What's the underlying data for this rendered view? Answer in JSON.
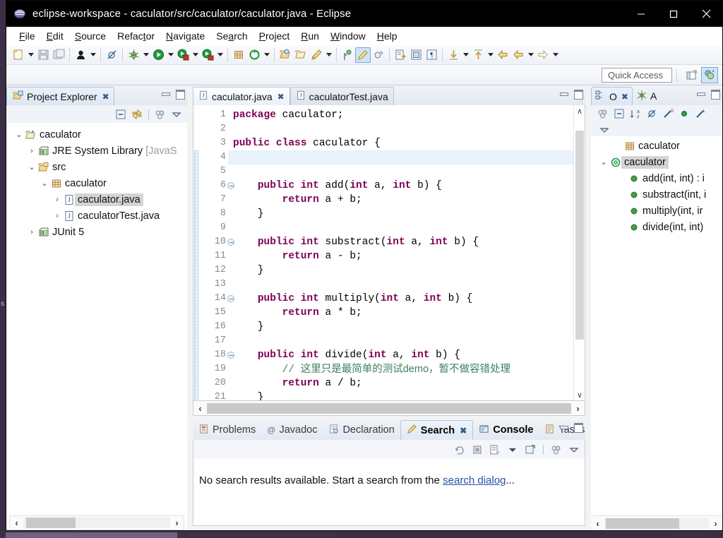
{
  "window": {
    "title": "eclipse-workspace - caculator/src/caculator/caculator.java - Eclipse",
    "icon": "eclipse-globe-icon",
    "minimize_label": "—",
    "maximize_label": "☐",
    "close_label": "✕"
  },
  "menubar": {
    "items": [
      {
        "label": "File",
        "mnemonic": "F"
      },
      {
        "label": "Edit",
        "mnemonic": "E"
      },
      {
        "label": "Source",
        "mnemonic": "S"
      },
      {
        "label": "Refactor",
        "mnemonic": "t"
      },
      {
        "label": "Navigate",
        "mnemonic": "N"
      },
      {
        "label": "Search",
        "mnemonic": "a"
      },
      {
        "label": "Project",
        "mnemonic": "P"
      },
      {
        "label": "Run",
        "mnemonic": "R"
      },
      {
        "label": "Window",
        "mnemonic": "W"
      },
      {
        "label": "Help",
        "mnemonic": "H"
      }
    ]
  },
  "toolbar": {
    "icons": [
      "new-wizard-icon",
      "save-icon",
      "save-all-icon",
      "toggle-breadcrumb-icon",
      "skip-breakpoints-icon",
      "debug-icon",
      "run-icon",
      "run-external-tools-icon",
      "coverage-icon",
      "new-java-package-icon",
      "new-java-class-icon",
      "open-type-icon",
      "open-task-icon",
      "search-icon",
      "next-annotation-icon",
      "previous-annotation-icon",
      "last-edit-location-icon",
      "back-icon",
      "forward-icon"
    ]
  },
  "quick_access": {
    "placeholder": "Quick Access",
    "value": "Quick Access",
    "open_perspective_icon": "open-perspective-icon",
    "java_perspective_icon": "java-perspective-icon"
  },
  "project_explorer": {
    "tab_label": "Project Explorer",
    "tab_icon": "project-explorer-icon",
    "close_label": "✖",
    "toolbar_icons": [
      "collapse-all-icon",
      "link-with-editor-icon",
      "view-menu-icon",
      "view-dropdown-icon"
    ],
    "tree": [
      {
        "label": "caculator",
        "indent": 0,
        "twist": "⌄",
        "icon": "java-project-icon",
        "selected": false,
        "dim": ""
      },
      {
        "label": "JRE System Library ",
        "indent": 1,
        "twist": "›",
        "icon": "library-icon",
        "selected": false,
        "dim": "[JavaS"
      },
      {
        "label": "src",
        "indent": 1,
        "twist": "⌄",
        "icon": "source-folder-icon",
        "selected": false,
        "dim": ""
      },
      {
        "label": "caculator",
        "indent": 2,
        "twist": "⌄",
        "icon": "package-icon",
        "selected": false,
        "dim": ""
      },
      {
        "label": "caculator.java",
        "indent": 3,
        "twist": "›",
        "icon": "java-file-icon",
        "selected": true,
        "dim": ""
      },
      {
        "label": "caculatorTest.java",
        "indent": 3,
        "twist": "›",
        "icon": "java-file-icon",
        "selected": false,
        "dim": ""
      },
      {
        "label": "JUnit 5",
        "indent": 1,
        "twist": "›",
        "icon": "library-icon",
        "selected": false,
        "dim": ""
      }
    ],
    "hscroll": {
      "left_arrow": "‹",
      "right_arrow": "›"
    }
  },
  "editor": {
    "tabs": [
      {
        "label": "caculator.java",
        "icon": "java-file-icon",
        "selected": true,
        "close": "✖"
      },
      {
        "label": "caculatorTest.java",
        "icon": "java-file-icon",
        "selected": false,
        "close": ""
      }
    ],
    "lines": [
      {
        "n": "1",
        "fold": false,
        "highlight": false,
        "tokens": [
          {
            "t": "package",
            "c": "kw"
          },
          {
            "t": " caculator;",
            "c": ""
          }
        ]
      },
      {
        "n": "2",
        "fold": false,
        "highlight": false,
        "tokens": [
          {
            "t": "",
            "c": ""
          }
        ]
      },
      {
        "n": "3",
        "fold": false,
        "highlight": false,
        "tokens": [
          {
            "t": "public class",
            "c": "kw"
          },
          {
            "t": " caculator {",
            "c": ""
          }
        ]
      },
      {
        "n": "4",
        "fold": false,
        "highlight": true,
        "tokens": [
          {
            "t": "",
            "c": ""
          }
        ]
      },
      {
        "n": "5",
        "fold": false,
        "highlight": false,
        "tokens": [
          {
            "t": "",
            "c": ""
          }
        ]
      },
      {
        "n": "6",
        "fold": true,
        "highlight": false,
        "tokens": [
          {
            "t": "\t",
            "c": ""
          },
          {
            "t": "public int",
            "c": "kw"
          },
          {
            "t": " add(",
            "c": ""
          },
          {
            "t": "int",
            "c": "kw"
          },
          {
            "t": " a, ",
            "c": ""
          },
          {
            "t": "int",
            "c": "kw"
          },
          {
            "t": " b) {",
            "c": ""
          }
        ]
      },
      {
        "n": "7",
        "fold": false,
        "highlight": false,
        "tokens": [
          {
            "t": "\t\t",
            "c": ""
          },
          {
            "t": "return",
            "c": "kw"
          },
          {
            "t": " a + b;",
            "c": ""
          }
        ]
      },
      {
        "n": "8",
        "fold": false,
        "highlight": false,
        "tokens": [
          {
            "t": "\t}",
            "c": ""
          }
        ]
      },
      {
        "n": "9",
        "fold": false,
        "highlight": false,
        "tokens": [
          {
            "t": "",
            "c": ""
          }
        ]
      },
      {
        "n": "10",
        "fold": true,
        "highlight": false,
        "tokens": [
          {
            "t": "\t",
            "c": ""
          },
          {
            "t": "public int",
            "c": "kw"
          },
          {
            "t": " substract(",
            "c": ""
          },
          {
            "t": "int",
            "c": "kw"
          },
          {
            "t": " a, ",
            "c": ""
          },
          {
            "t": "int",
            "c": "kw"
          },
          {
            "t": " b) {",
            "c": ""
          }
        ]
      },
      {
        "n": "11",
        "fold": false,
        "highlight": false,
        "tokens": [
          {
            "t": "\t\t",
            "c": ""
          },
          {
            "t": "return",
            "c": "kw"
          },
          {
            "t": " a - b;",
            "c": ""
          }
        ]
      },
      {
        "n": "12",
        "fold": false,
        "highlight": false,
        "tokens": [
          {
            "t": "\t}",
            "c": ""
          }
        ]
      },
      {
        "n": "13",
        "fold": false,
        "highlight": false,
        "tokens": [
          {
            "t": "",
            "c": ""
          }
        ]
      },
      {
        "n": "14",
        "fold": true,
        "highlight": false,
        "tokens": [
          {
            "t": "\t",
            "c": ""
          },
          {
            "t": "public int",
            "c": "kw"
          },
          {
            "t": " multiply(",
            "c": ""
          },
          {
            "t": "int",
            "c": "kw"
          },
          {
            "t": " a, ",
            "c": ""
          },
          {
            "t": "int",
            "c": "kw"
          },
          {
            "t": " b) {",
            "c": ""
          }
        ]
      },
      {
        "n": "15",
        "fold": false,
        "highlight": false,
        "tokens": [
          {
            "t": "\t\t",
            "c": ""
          },
          {
            "t": "return",
            "c": "kw"
          },
          {
            "t": " a * b;",
            "c": ""
          }
        ]
      },
      {
        "n": "16",
        "fold": false,
        "highlight": false,
        "tokens": [
          {
            "t": "\t}",
            "c": ""
          }
        ]
      },
      {
        "n": "17",
        "fold": false,
        "highlight": false,
        "tokens": [
          {
            "t": "",
            "c": ""
          }
        ]
      },
      {
        "n": "18",
        "fold": true,
        "highlight": false,
        "tokens": [
          {
            "t": "\t",
            "c": ""
          },
          {
            "t": "public int",
            "c": "kw"
          },
          {
            "t": " divide(",
            "c": ""
          },
          {
            "t": "int",
            "c": "kw"
          },
          {
            "t": " a, ",
            "c": ""
          },
          {
            "t": "int",
            "c": "kw"
          },
          {
            "t": " b) {",
            "c": ""
          }
        ]
      },
      {
        "n": "19",
        "fold": false,
        "highlight": false,
        "tokens": [
          {
            "t": "\t\t",
            "c": ""
          },
          {
            "t": "// ",
            "c": "cmt"
          },
          {
            "t": "这里只是最简单的测试demo，暂不做容错处理",
            "c": "cmt-cn"
          }
        ]
      },
      {
        "n": "20",
        "fold": false,
        "highlight": false,
        "tokens": [
          {
            "t": "\t\t",
            "c": ""
          },
          {
            "t": "return",
            "c": "kw"
          },
          {
            "t": " a / b;",
            "c": ""
          }
        ]
      },
      {
        "n": "21",
        "fold": false,
        "highlight": false,
        "tokens": [
          {
            "t": "\t}",
            "c": ""
          }
        ]
      }
    ],
    "vscroll": {
      "up": "∧",
      "down": "∨"
    },
    "hscroll": {
      "left_arrow": "‹",
      "right_arrow": "›"
    }
  },
  "outline": {
    "tabs": [
      {
        "label": "O",
        "icon": "outline-icon",
        "selected": true,
        "close": "✖"
      },
      {
        "label": "A",
        "icon": "junit-icon",
        "selected": false,
        "close": ""
      }
    ],
    "toolbar_icons": [
      "view-menu-icon",
      "collapse-all-icon",
      "sort-icon",
      "hide-fields-icon",
      "hide-static-icon",
      "hide-nonpublic-icon",
      "hide-local-types-icon",
      "view-dropdown-icon"
    ],
    "tree": [
      {
        "label": "caculator",
        "indent": 1,
        "twist": "",
        "icon": "package-icon",
        "selected": false
      },
      {
        "label": "caculator",
        "indent": 0,
        "twist": "⌄",
        "icon": "class-icon",
        "selected": true
      },
      {
        "label": "add(int, int) : i",
        "indent": 2,
        "twist": "",
        "icon": "method-public-icon",
        "selected": false
      },
      {
        "label": "substract(int, i",
        "indent": 2,
        "twist": "",
        "icon": "method-public-icon",
        "selected": false
      },
      {
        "label": "multiply(int, ir",
        "indent": 2,
        "twist": "",
        "icon": "method-public-icon",
        "selected": false
      },
      {
        "label": "divide(int, int)",
        "indent": 2,
        "twist": "",
        "icon": "method-public-icon",
        "selected": false
      }
    ],
    "hscroll": {
      "left_arrow": "‹",
      "right_arrow": "›"
    }
  },
  "bottom_view": {
    "tabs": [
      {
        "label": "Problems",
        "icon": "problems-icon",
        "selected": false,
        "bold": false,
        "close": ""
      },
      {
        "label": "Javadoc",
        "icon": "javadoc-icon",
        "selected": false,
        "bold": false,
        "close": ""
      },
      {
        "label": "Declaration",
        "icon": "declaration-icon",
        "selected": false,
        "bold": false,
        "close": ""
      },
      {
        "label": "Search",
        "icon": "search-icon",
        "selected": true,
        "bold": true,
        "close": "✖"
      },
      {
        "label": "Console",
        "icon": "console-icon",
        "selected": false,
        "bold": true,
        "close": ""
      },
      {
        "label": "Tasks",
        "icon": "tasks-icon",
        "selected": false,
        "bold": false,
        "close": ""
      }
    ],
    "toolbar_icons": [
      "rerun-search-icon",
      "cancel-icon",
      "show-previous-searches-icon",
      "dropdown-icon",
      "pin-search-icon",
      "view-menu-icon",
      "view-dropdown-icon"
    ],
    "message_prefix": "No search results available. Start a search from the ",
    "message_link": "search dialog",
    "message_suffix": "..."
  },
  "colors": {
    "titlebar_bg": "#000000",
    "keyword": "#7f0055",
    "comment": "#3f7f5f",
    "link": "#2a4ea8",
    "selection": "#d4d4d4",
    "current_line": "#e8f2fb",
    "desktop": "#3a2f44"
  }
}
